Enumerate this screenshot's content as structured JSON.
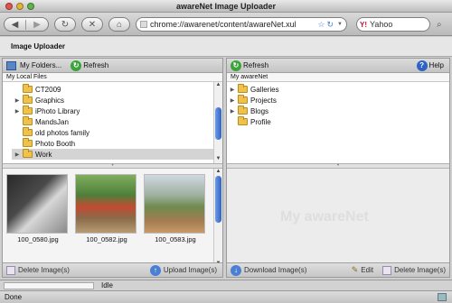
{
  "window": {
    "title": "awareNet Image Uploader"
  },
  "toolbar": {
    "url": "chrome://awarenet/content/awareNet.xul",
    "search_engine": "Yahoo"
  },
  "app": {
    "header": "Image Uploader"
  },
  "left_panel": {
    "toolbar": {
      "folders_label": "My Folders...",
      "refresh_label": "Refresh"
    },
    "tree_header": "My Local Files",
    "folders": [
      {
        "label": "CT2009",
        "expandable": false
      },
      {
        "label": "Graphics",
        "expandable": true
      },
      {
        "label": "iPhoto Library",
        "expandable": true
      },
      {
        "label": "MandsJan",
        "expandable": false
      },
      {
        "label": "old photos family",
        "expandable": false
      },
      {
        "label": "Photo Booth",
        "expandable": false
      },
      {
        "label": "Work",
        "expandable": true,
        "selected": true
      }
    ],
    "photos": [
      {
        "name": "100_0580.jpg"
      },
      {
        "name": "100_0582.jpg"
      },
      {
        "name": "100_0583.jpg"
      }
    ],
    "footer": {
      "delete_label": "Delete Image(s)",
      "upload_label": "Upload Image(s)"
    }
  },
  "right_panel": {
    "toolbar": {
      "refresh_label": "Refresh",
      "help_label": "Help"
    },
    "tree_header": "My awareNet",
    "folders": [
      {
        "label": "Galleries",
        "expandable": true
      },
      {
        "label": "Projects",
        "expandable": true
      },
      {
        "label": "Blogs",
        "expandable": true
      },
      {
        "label": "Profile",
        "expandable": false
      }
    ],
    "watermark": "My awareNet",
    "footer": {
      "download_label": "Download Image(s)",
      "edit_label": "Edit",
      "delete_label": "Delete Image(s)"
    }
  },
  "status": {
    "text": "Idle",
    "done": "Done"
  },
  "colors": {
    "accent": "#2e63c6",
    "folder": "#f1c24b",
    "refresh": "#3aa33a"
  }
}
